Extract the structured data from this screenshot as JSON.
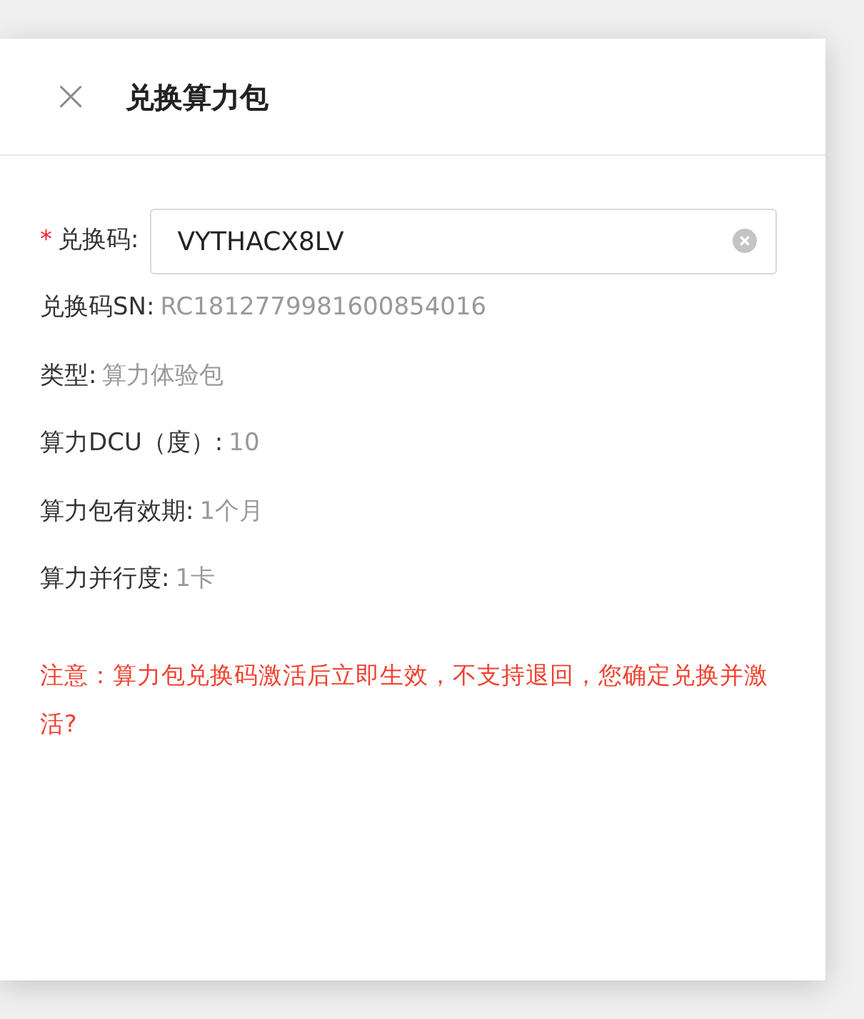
{
  "dialog": {
    "title": "兑换算力包",
    "close": "×"
  },
  "code_field": {
    "required_mark": "*",
    "label": "兑换码:",
    "value": "VYTHACX8LV"
  },
  "details": [
    {
      "label": "兑换码SN:",
      "value": "RC1812779981600854016"
    },
    {
      "label": "类型:",
      "value": "算力体验包"
    },
    {
      "label": "算力DCU（度）:",
      "value": "10"
    },
    {
      "label": "算力包有效期:",
      "value": "1个月"
    },
    {
      "label": "算力并行度:",
      "value": "1卡"
    }
  ],
  "warning": "注意：算力包兑换码激活后立即生效，不支持退回，您确定兑换并激活?"
}
